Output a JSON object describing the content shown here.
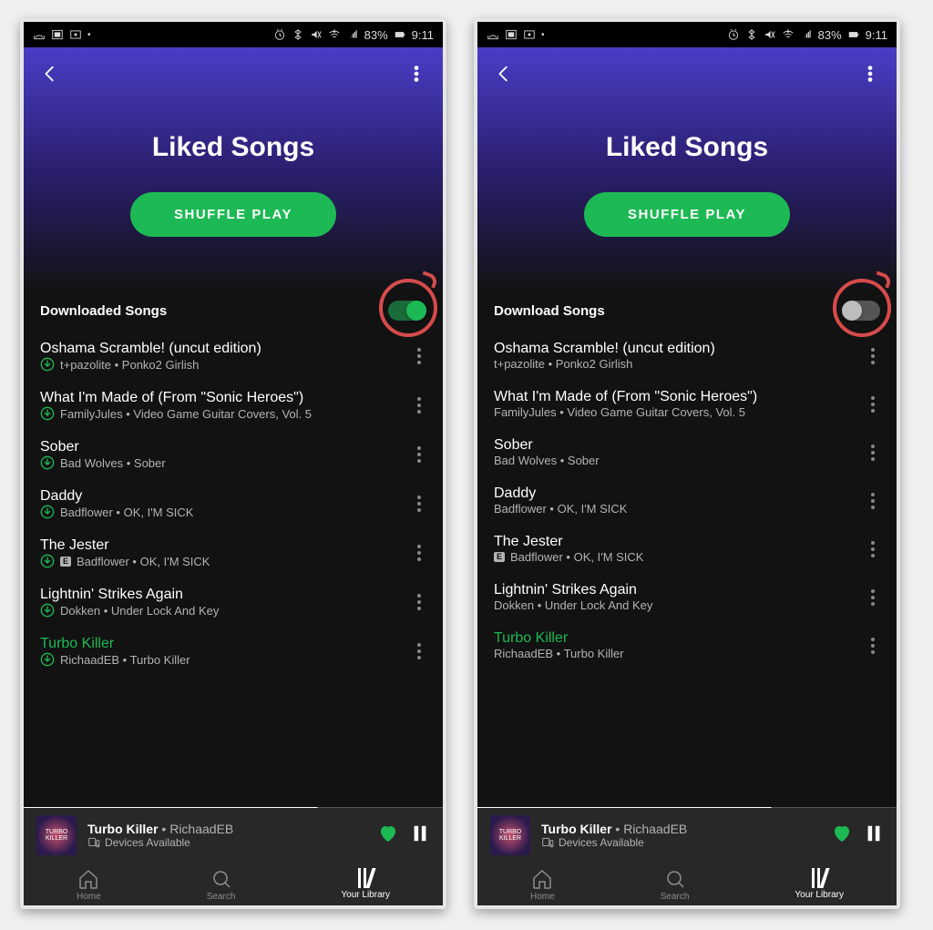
{
  "statusbar": {
    "battery": "83%",
    "time": "9:11"
  },
  "header": {
    "title": "Liked Songs",
    "shuffle_label": "SHUFFLE PLAY"
  },
  "panes": [
    {
      "download_label": "Downloaded Songs",
      "toggle_on": true,
      "show_download_icons": true
    },
    {
      "download_label": "Download Songs",
      "toggle_on": false,
      "show_download_icons": false
    }
  ],
  "tracks": [
    {
      "title": "Oshama Scramble! (uncut edition)",
      "artist": "t+pazolite",
      "album": "Ponko2 Girlish",
      "explicit": false,
      "playing": false
    },
    {
      "title": "What I'm Made of (From \"Sonic Heroes\")",
      "artist": "FamilyJules",
      "album": "Video Game Guitar Covers, Vol. 5",
      "explicit": false,
      "playing": false
    },
    {
      "title": "Sober",
      "artist": "Bad Wolves",
      "album": "Sober",
      "explicit": false,
      "playing": false
    },
    {
      "title": "Daddy",
      "artist": "Badflower",
      "album": "OK, I'M SICK",
      "explicit": false,
      "playing": false
    },
    {
      "title": "The Jester",
      "artist": "Badflower",
      "album": "OK, I'M SICK",
      "explicit": true,
      "playing": false
    },
    {
      "title": "Lightnin' Strikes Again",
      "artist": "Dokken",
      "album": "Under Lock And Key",
      "explicit": false,
      "playing": false
    },
    {
      "title": "Turbo Killer",
      "artist": "RichaadEB",
      "album": "Turbo Killer",
      "explicit": false,
      "playing": true
    }
  ],
  "nowplaying": {
    "title": "Turbo Killer",
    "artist": "RichaadEB",
    "devices": "Devices Available"
  },
  "nav": {
    "home": "Home",
    "search": "Search",
    "library": "Your Library"
  }
}
